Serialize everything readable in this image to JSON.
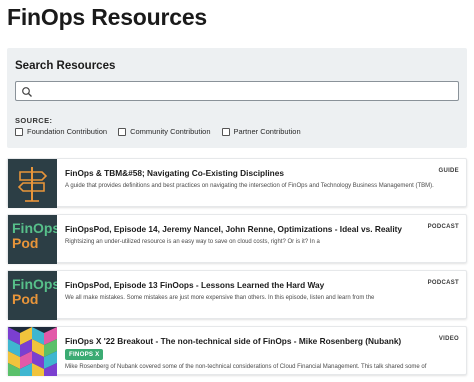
{
  "page": {
    "title": "FinOps Resources"
  },
  "search": {
    "heading": "Search Resources",
    "placeholder": "",
    "value": "",
    "source_label": "SOURCE:",
    "filters": [
      {
        "label": "Foundation Contribution",
        "checked": false
      },
      {
        "label": "Community Contribution",
        "checked": false
      },
      {
        "label": "Partner Contribution",
        "checked": false
      }
    ]
  },
  "resources": [
    {
      "title": "FinOps & TBM&#58; Navigating Co-Existing Disciplines",
      "description": "A guide that provides definitions and best practices on navigating the intersection of FinOps and Technology Business Management (TBM).",
      "type": "GUIDE",
      "thumbnail": "signpost-icon"
    },
    {
      "title": "FinOpsPod, Episode 14, Jeremy Nancel, John Renne, Optimizations - Ideal vs. Reality",
      "description": "Rightsizing an under-utilized resource is an easy way to save on cloud costs, right? Or is it? In a",
      "type": "PODCAST",
      "thumbnail": "finops-pod-logo",
      "thumb_text": [
        "FinOps",
        "Pod"
      ]
    },
    {
      "title": "FinOpsPod, Episode 13 FinOops - Lessons Learned the Hard Way",
      "description": "We all make mistakes. Some mistakes are just more expensive than others. In this episode, listen and learn from the",
      "type": "PODCAST",
      "thumbnail": "finops-pod-logo",
      "thumb_text": [
        "FinOps",
        "Pod"
      ]
    },
    {
      "title": "FinOps X '22 Breakout - The non-technical side of FinOps - Mike Rosenberg (Nubank)",
      "description": "Mike Rosenberg of Nubank covered some of the non-technical considerations of Cloud Financial Management. This talk shared some of",
      "type": "VIDEO",
      "tag": "FINOPS X",
      "thumbnail": "isometric-cubes-pattern"
    }
  ],
  "colors": {
    "panel_bg": "#edf0f2",
    "thumb_dark": "#2c3e45",
    "thumb_orange": "#e8953a",
    "pod_green": "#57c08a",
    "tag_green": "#3bab73"
  }
}
